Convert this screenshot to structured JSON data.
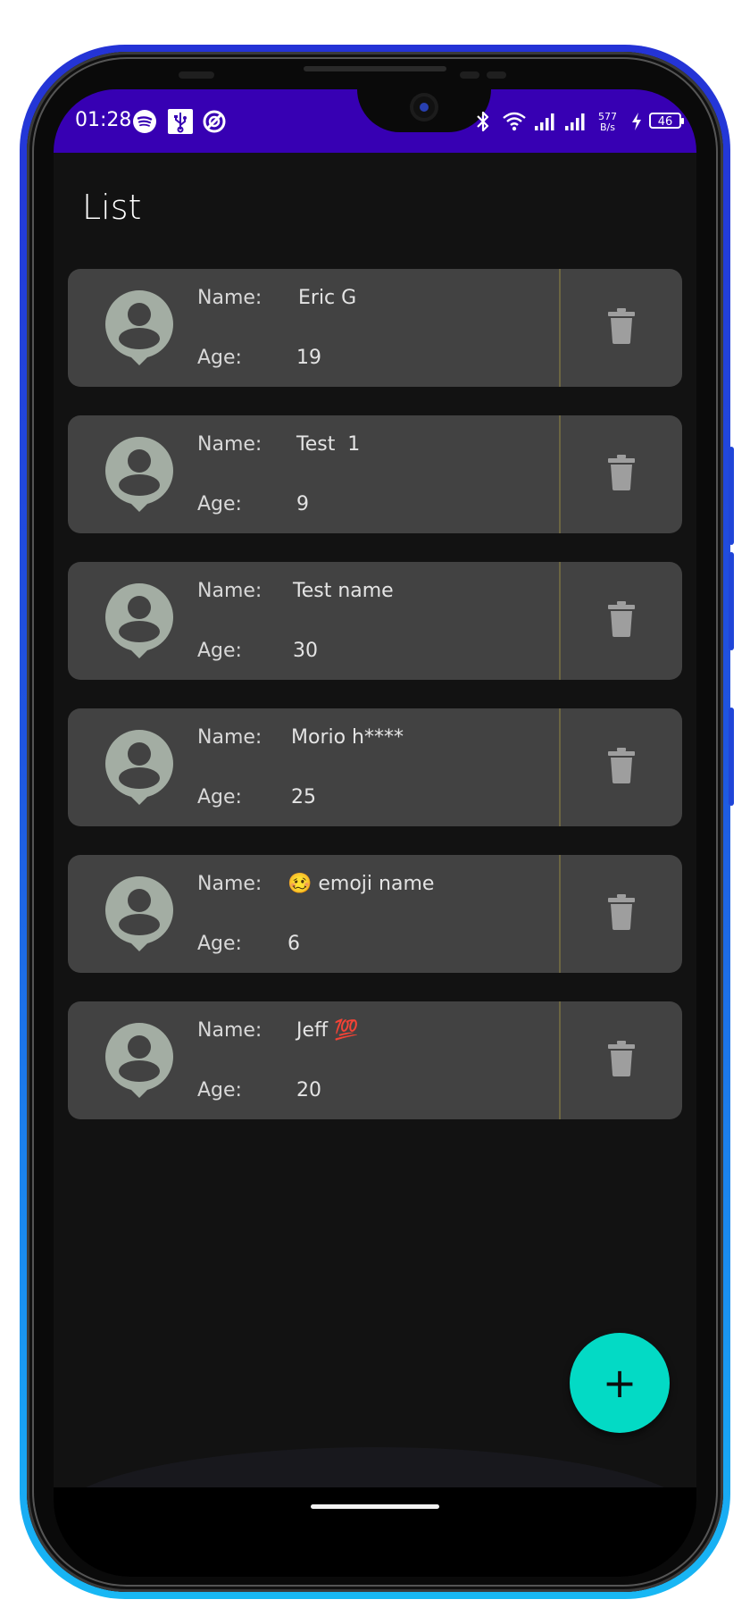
{
  "status_bar": {
    "time": "01:28",
    "left_icons": [
      "spotify-icon",
      "usb-icon",
      "vpn-icon"
    ],
    "right_icons": [
      "bluetooth-icon",
      "wifi-icon",
      "signal-icon",
      "signal-icon"
    ],
    "net_speed_value": "577",
    "net_speed_unit": "B/s",
    "battery": "46",
    "background": "#3700b3"
  },
  "page": {
    "title": "List"
  },
  "labels": {
    "name": "Name:",
    "age": "Age:"
  },
  "people": [
    {
      "name": "Eric G",
      "age": "19"
    },
    {
      "name": "Test  1",
      "age": "9"
    },
    {
      "name": "Test name",
      "age": "30"
    },
    {
      "name": "Morio h****",
      "age": "25"
    },
    {
      "name": "🥴 emoji name",
      "age": "6"
    },
    {
      "name": "Jeff 💯",
      "age": "20"
    }
  ],
  "fab": {
    "label": "+",
    "color": "#03dac5"
  },
  "colors": {
    "card": "#424242",
    "avatar": "#a3ada3",
    "trash": "#9e9e9e",
    "background": "#121212"
  }
}
